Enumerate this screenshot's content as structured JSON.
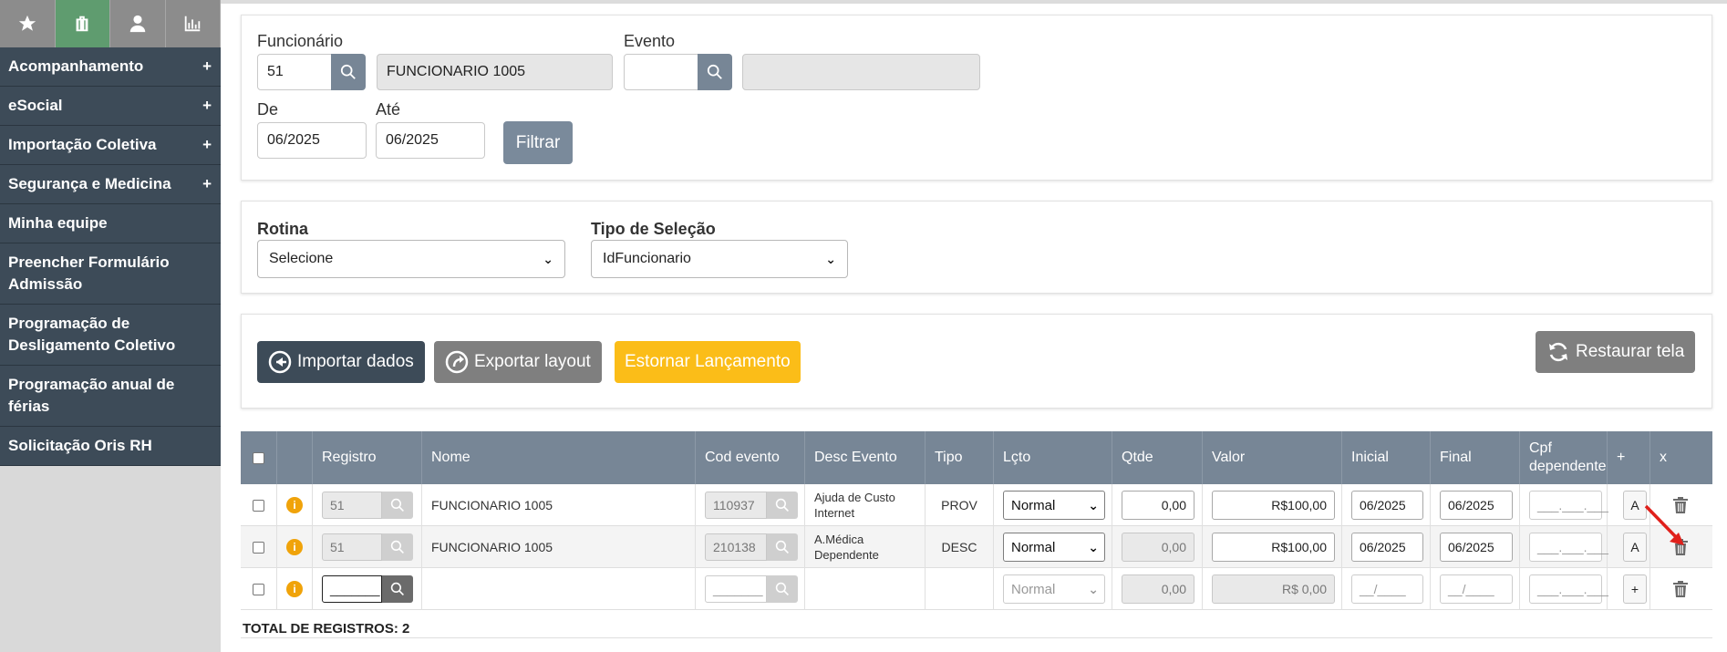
{
  "sidebar": {
    "tabs": [
      {
        "icon": "star-icon"
      },
      {
        "icon": "briefcase-icon"
      },
      {
        "icon": "person-icon"
      },
      {
        "icon": "bar-chart-icon"
      }
    ],
    "items": [
      {
        "label": "Acompanhamento",
        "plus": "+"
      },
      {
        "label": "eSocial",
        "plus": "+"
      },
      {
        "label": "Importação Coletiva",
        "plus": "+"
      },
      {
        "label": "Segurança e Medicina",
        "plus": "+"
      },
      {
        "label": "Minha equipe"
      },
      {
        "label": "Preencher Formulário Admissão"
      },
      {
        "label": "Programação de Desligamento Coletivo"
      },
      {
        "label": "Programação anual de férias"
      },
      {
        "label": "Solicitação Oris RH"
      }
    ]
  },
  "filters": {
    "funcionario_label": "Funcionário",
    "funcionario_value": "51",
    "funcionario_name": "FUNCIONARIO 1005",
    "evento_label": "Evento",
    "evento_value": "",
    "evento_desc": "",
    "de_label": "De",
    "de_value": "06/2025",
    "ate_label": "Até",
    "ate_value": "06/2025",
    "filtrar_label": "Filtrar"
  },
  "selection": {
    "rotina_label": "Rotina",
    "rotina_value": "Selecione",
    "tipo_label": "Tipo de Seleção",
    "tipo_value": "IdFuncionario"
  },
  "actions": {
    "importar": "Importar dados",
    "exportar": "Exportar layout",
    "estornar": "Estornar Lançamento",
    "restaurar": "Restaurar tela"
  },
  "table": {
    "headers": {
      "registro": "Registro",
      "nome": "Nome",
      "cod_evento": "Cod evento",
      "desc_evento": "Desc Evento",
      "tipo": "Tipo",
      "lcto": "Lçto",
      "qtde": "Qtde",
      "valor": "Valor",
      "inicial": "Inicial",
      "final": "Final",
      "cpf": "Cpf dependente",
      "plus": "+",
      "x": "x"
    },
    "rows": [
      {
        "registro": "51",
        "nome": "FUNCIONARIO 1005",
        "cod_evento": "110937",
        "desc_evento": "Ajuda de Custo Internet",
        "tipo": "PROV",
        "lcto": "Normal",
        "qtde": "0,00",
        "valor": "R$100,00",
        "inicial": "06/2025",
        "final": "06/2025",
        "cpf": "___.___.___",
        "action": "A"
      },
      {
        "registro": "51",
        "nome": "FUNCIONARIO 1005",
        "cod_evento": "210138",
        "desc_evento": "A.Médica Dependente",
        "tipo": "DESC",
        "lcto": "Normal",
        "qtde": "0,00",
        "valor": "R$100,00",
        "inicial": "06/2025",
        "final": "06/2025",
        "cpf": "___.___.___",
        "action": "A"
      },
      {
        "registro": "_______",
        "nome": "",
        "cod_evento": "_______",
        "desc_evento": "",
        "tipo": "",
        "lcto": "Normal",
        "qtde": "0,00",
        "valor": "R$ 0,00",
        "inicial": "__/____",
        "final": "__/____",
        "cpf": "___.___.___",
        "action": "+"
      }
    ],
    "total_label": "TOTAL DE REGISTROS: 2"
  },
  "colors": {
    "sidebar_menu": "#3d4b58",
    "sidebar_tab_active": "#5f9c6f",
    "table_header": "#778696",
    "estornar_button": "#fbbd18",
    "importar_button": "#3d4b58",
    "exportar_button": "#7f7f7f",
    "info_icon": "#f0a30a"
  }
}
